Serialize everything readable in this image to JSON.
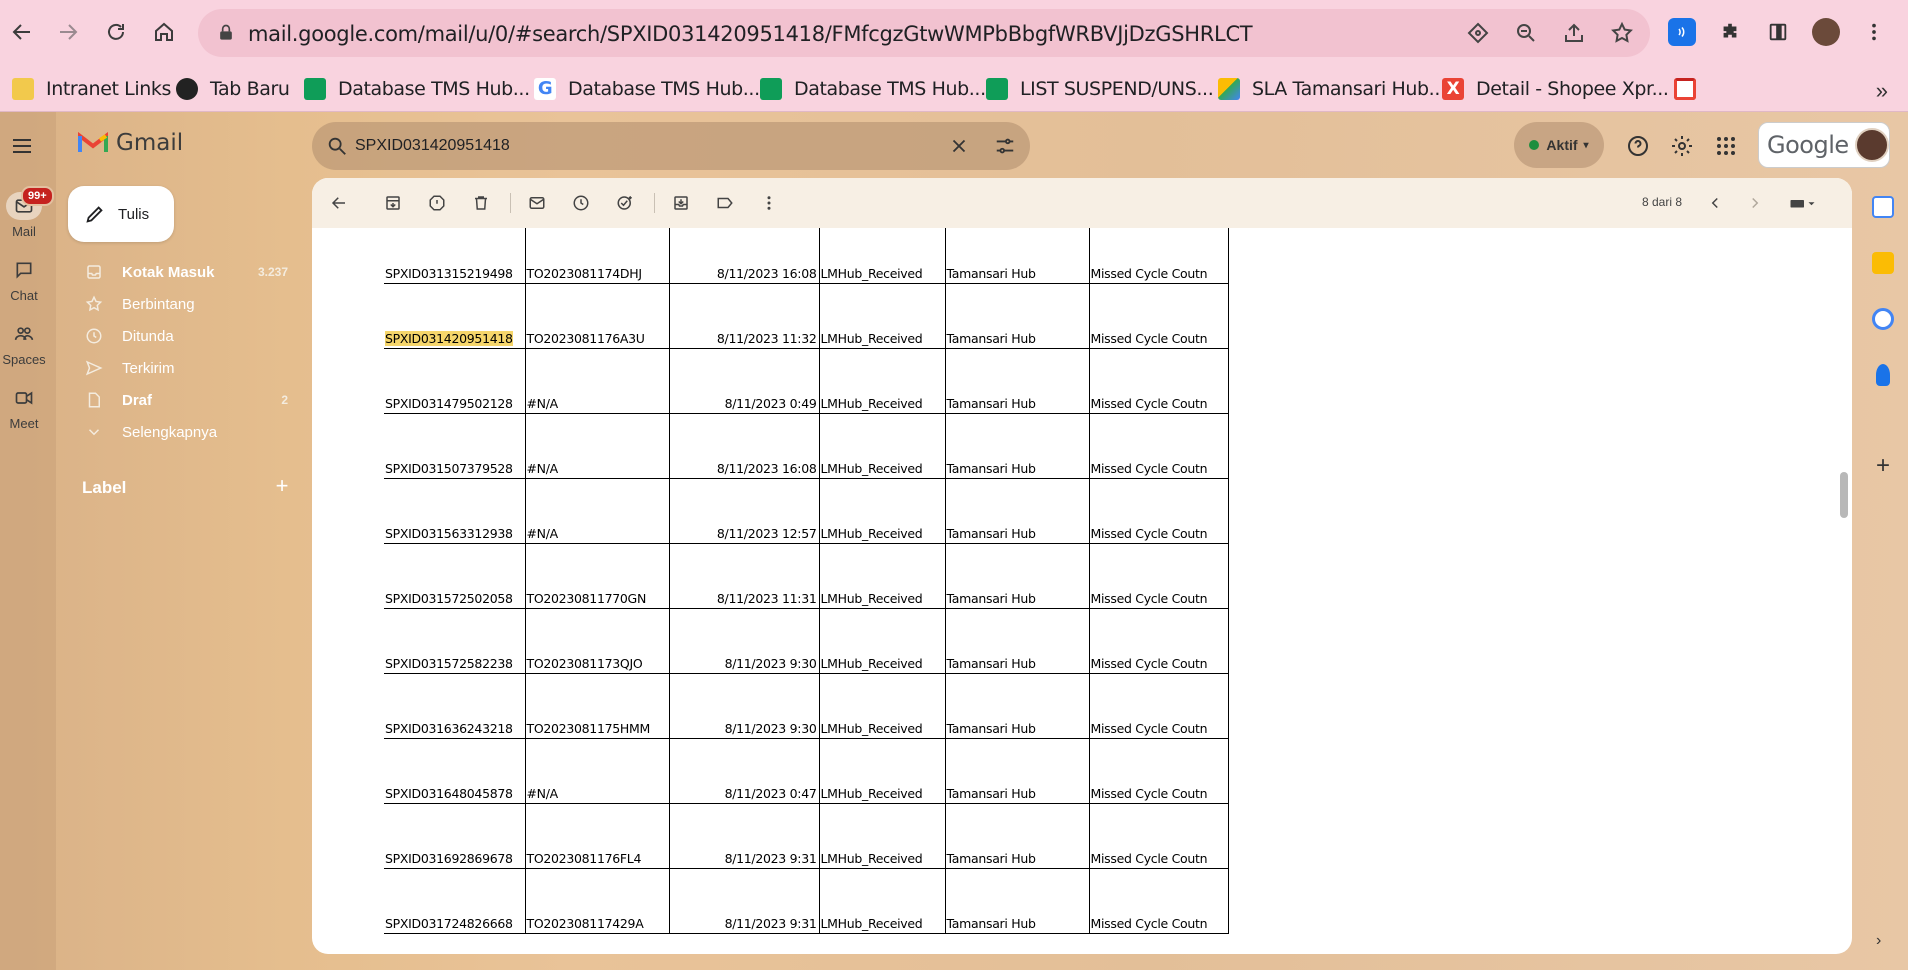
{
  "browser": {
    "url": "mail.google.com/mail/u/0/#search/SPXID031420951418/FMfcgzGtwWMPbBbgfWRBVJjDzGSHRLCT",
    "bookmarks": [
      {
        "label": "Intranet Links",
        "color": "#f2c94c"
      },
      {
        "label": "Tab Baru",
        "color": "#222222"
      },
      {
        "label": "Database TMS Hub...",
        "color": "#0f9d58"
      },
      {
        "label": "Database TMS Hub...",
        "color": "#4285f4"
      },
      {
        "label": "Database TMS Hub...",
        "color": "#0f9d58"
      },
      {
        "label": "LIST SUSPEND/UNS...",
        "color": "#0f9d58"
      },
      {
        "label": "SLA Tamansari Hub...",
        "color": "#fbbc04"
      },
      {
        "label": "Detail - Shopee Xpr...",
        "color": "#ea4335"
      }
    ],
    "more": "»"
  },
  "gmail": {
    "logo_text": "Gmail",
    "search": {
      "value": "SPXID031420951418"
    },
    "status": "Aktif",
    "account_brand": "Google",
    "compose_label": "Tulis",
    "rail": [
      {
        "label": "Mail",
        "badge": "99+"
      },
      {
        "label": "Chat"
      },
      {
        "label": "Spaces"
      },
      {
        "label": "Meet"
      }
    ],
    "nav": [
      {
        "label": "Kotak Masuk",
        "count": "3.237",
        "bold": true
      },
      {
        "label": "Berbintang",
        "count": ""
      },
      {
        "label": "Ditunda",
        "count": ""
      },
      {
        "label": "Terkirim",
        "count": ""
      },
      {
        "label": "Draf",
        "count": "2",
        "bold": true
      },
      {
        "label": "Selengkapnya",
        "count": ""
      }
    ],
    "label_header": "Label",
    "pager": "8 dari 8"
  },
  "table": {
    "rows": [
      [
        "SPXID031315219498",
        "TO2023081174DHJ",
        "8/11/2023 16:08",
        "LMHub_Received",
        "Tamansari Hub",
        "Missed Cycle Coutn"
      ],
      [
        "SPXID031420951418",
        "TO2023081176A3U",
        "8/11/2023 11:32",
        "LMHub_Received",
        "Tamansari Hub",
        "Missed Cycle Coutn"
      ],
      [
        "SPXID031479502128",
        "#N/A",
        "8/11/2023 0:49",
        "LMHub_Received",
        "Tamansari Hub",
        "Missed Cycle Coutn"
      ],
      [
        "SPXID031507379528",
        "#N/A",
        "8/11/2023 16:08",
        "LMHub_Received",
        "Tamansari Hub",
        "Missed Cycle Coutn"
      ],
      [
        "SPXID031563312938",
        "#N/A",
        "8/11/2023 12:57",
        "LMHub_Received",
        "Tamansari Hub",
        "Missed Cycle Coutn"
      ],
      [
        "SPXID031572502058",
        "TO20230811770GN",
        "8/11/2023 11:31",
        "LMHub_Received",
        "Tamansari Hub",
        "Missed Cycle Coutn"
      ],
      [
        "SPXID031572582238",
        "TO2023081173QJO",
        "8/11/2023 9:30",
        "LMHub_Received",
        "Tamansari Hub",
        "Missed Cycle Coutn"
      ],
      [
        "SPXID031636243218",
        "TO2023081175HMM",
        "8/11/2023 9:30",
        "LMHub_Received",
        "Tamansari Hub",
        "Missed Cycle Coutn"
      ],
      [
        "SPXID031648045878",
        "#N/A",
        "8/11/2023 0:47",
        "LMHub_Received",
        "Tamansari Hub",
        "Missed Cycle Coutn"
      ],
      [
        "SPXID031692869678",
        "TO2023081176FL4",
        "8/11/2023 9:31",
        "LMHub_Received",
        "Tamansari Hub",
        "Missed Cycle Coutn"
      ],
      [
        "SPXID031724826668",
        "TO202308117429A",
        "8/11/2023 9:31",
        "LMHub_Received",
        "Tamansari Hub",
        "Missed Cycle Coutn"
      ]
    ],
    "highlight_row": 1,
    "highlight_color": "#f6d66b"
  }
}
